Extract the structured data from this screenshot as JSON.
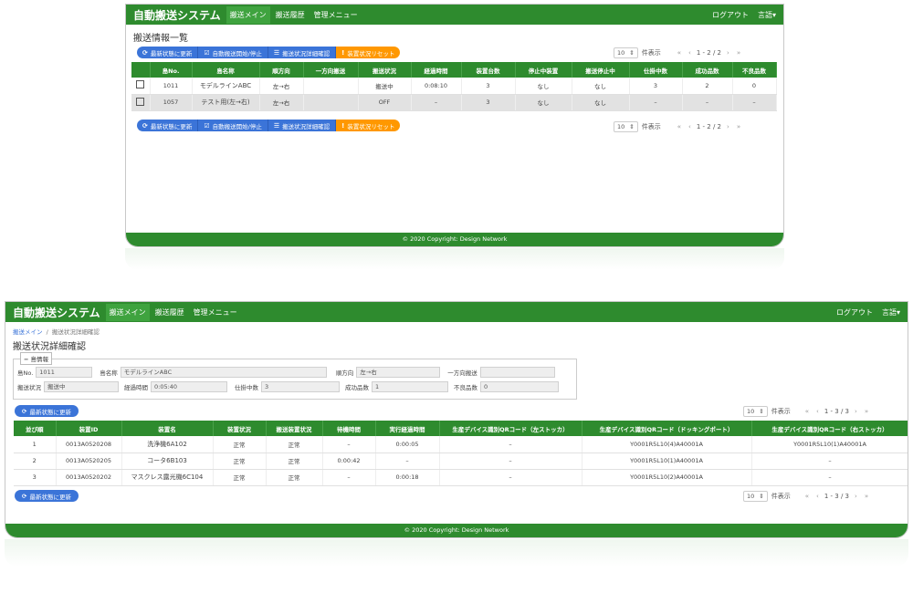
{
  "app_title": "自動搬送システム",
  "nav": {
    "items": [
      "搬送メイン",
      "搬送履歴",
      "管理メニュー"
    ],
    "logout": "ログアウト",
    "language": "言語",
    "language_caret": "▾"
  },
  "footer": "© 2020 Copyright: Design Network",
  "list_screen": {
    "title": "搬送情報一覧",
    "buttons": [
      {
        "icon": "⟳",
        "label": "最新状態に更新"
      },
      {
        "icon": "☑",
        "label": "自動搬送開始/停止"
      },
      {
        "icon": "☰",
        "label": "搬送状況詳細確認"
      },
      {
        "icon": "!",
        "label": "装置状況リセット"
      }
    ],
    "pager": {
      "size": "10",
      "size_caret": "⇕",
      "per_page": "件表示",
      "first": "«",
      "prev": "‹",
      "range": "1 - 2 / 2",
      "next": "›",
      "last": "»"
    },
    "columns": [
      "島No.",
      "島名称",
      "順方向",
      "一方向搬送",
      "搬送状況",
      "経過時間",
      "装置台数",
      "停止中装置",
      "搬送停止中",
      "仕掛中数",
      "成功品数",
      "不良品数"
    ],
    "rows": [
      {
        "cells": [
          "1011",
          "モデルラインABC",
          "左→右",
          "",
          "搬送中",
          "0:08:10",
          "3",
          "なし",
          "なし",
          "3",
          "2",
          "0"
        ],
        "style": "white"
      },
      {
        "cells": [
          "1057",
          "テスト用(左→右)",
          "左→右",
          "",
          "OFF",
          "–",
          "3",
          "なし",
          "なし",
          "–",
          "–",
          "–"
        ],
        "style": "gray"
      }
    ]
  },
  "detail_screen": {
    "breadcrumb": {
      "link": "搬送メイン",
      "sep": "/",
      "current": "搬送状況詳細確認"
    },
    "title": "搬送状況詳細確認",
    "info_legend": "島情報",
    "info_legend_icon": "−",
    "info": {
      "island_no_label": "島No.",
      "island_no": "1011",
      "island_name_label": "島名称",
      "island_name": "モデルラインABC",
      "direction_label": "順方向",
      "direction": "左→右",
      "oneway_label": "一方向搬送",
      "oneway": "",
      "status_label": "搬送状況",
      "status": "搬送中",
      "elapsed_label": "経過時間",
      "elapsed": "0:05:40",
      "wip_label": "仕掛中数",
      "wip": "3",
      "success_label": "成功品数",
      "success": "1",
      "defect_label": "不良品数",
      "defect": "0"
    },
    "refresh_button": {
      "icon": "⟳",
      "label": "最新状態に更新"
    },
    "pager": {
      "size": "10",
      "size_caret": "⇕",
      "per_page": "件表示",
      "first": "«",
      "prev": "‹",
      "range": "1 - 3 / 3",
      "next": "›",
      "last": "»"
    },
    "columns": [
      "並び順",
      "装置ID",
      "装置名",
      "装置状況",
      "搬送装置状況",
      "待機時間",
      "実行経過時間",
      "生産デバイス識別QRコード（左ストッカ）",
      "生産デバイス識別QRコード（ドッキングポート）",
      "生産デバイス識別QRコード（右ストッカ）"
    ],
    "rows": [
      [
        "1",
        "0013A0520208",
        "洗浄機6A102",
        "正常",
        "正常",
        "–",
        "0:00:05",
        "–",
        "Y0001R5L10(4)A40001A",
        "Y0001R5L10(1)A40001A"
      ],
      [
        "2",
        "0013A0520205",
        "コータ6B103",
        "正常",
        "正常",
        "0:00:42",
        "–",
        "–",
        "Y0001R5L10(1)A40001A",
        "–"
      ],
      [
        "3",
        "0013A0520202",
        "マスクレス露光機6C104",
        "正常",
        "正常",
        "–",
        "0:00:18",
        "–",
        "Y0001R5L10(2)A40001A",
        "–"
      ]
    ]
  }
}
